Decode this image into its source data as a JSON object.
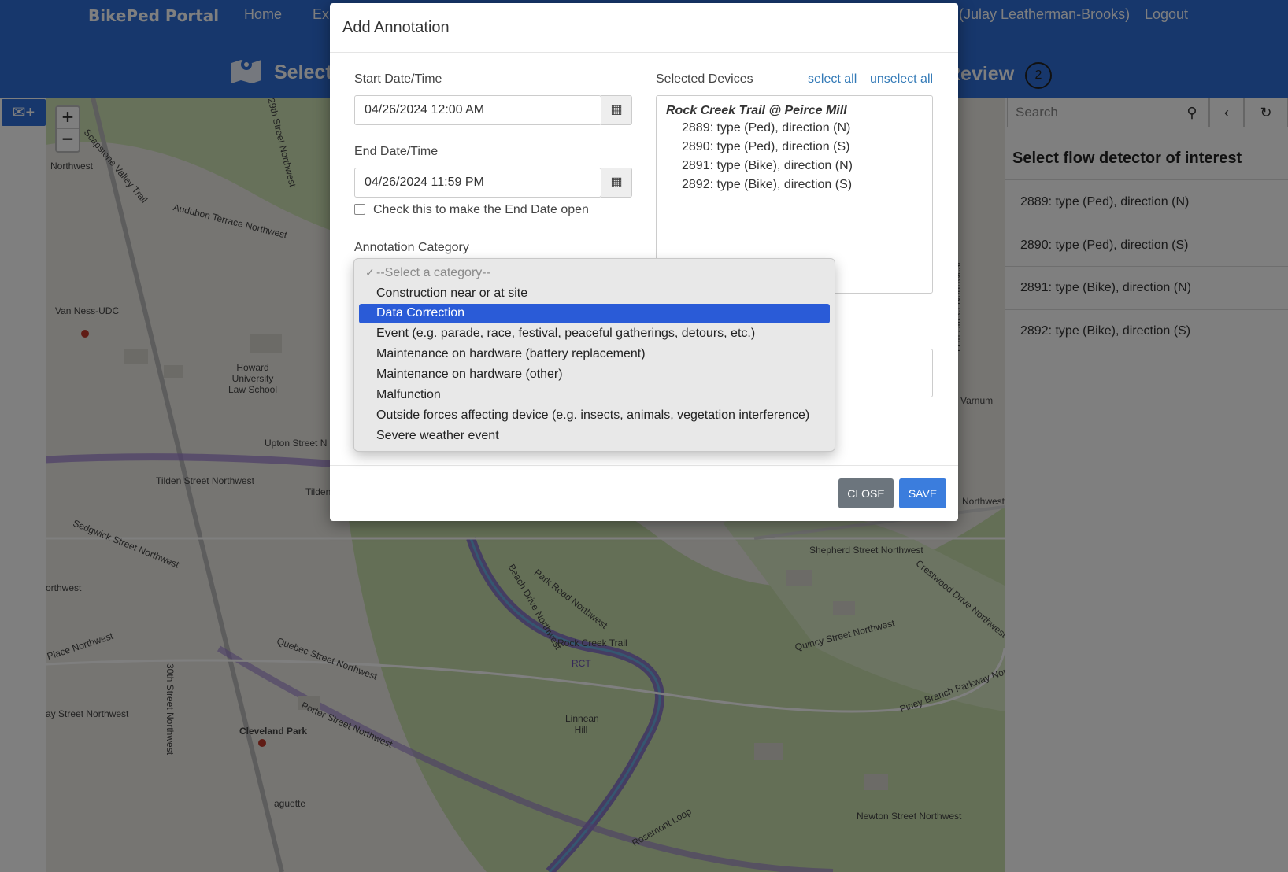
{
  "navbar": {
    "brand": "BikePed Portal",
    "links": [
      "Home",
      "Exp",
      "(Julay Leatherman-Brooks)",
      "Logout"
    ]
  },
  "stepbar": {
    "select_label": "Select",
    "review_label": "Review",
    "review_number": "2"
  },
  "map": {
    "labels": [
      "Van Ness-UDC",
      "Howard University Law School",
      "Upton Street N",
      "Tilden Street Northwest",
      "Tilden Stre",
      "Sedgwick Street Northwest",
      "Quebec Street Northwest",
      "Porter Street Northwest",
      "Cleveland Park",
      "Linnean Hill",
      "RCT",
      "Rock Creek Trail",
      "Park Road Northwest",
      "Beach Drive Northwest",
      "Shepherd Street Northwest",
      "Quincy Street Northwest",
      "Crestwood Drive Northwest",
      "Piney Branch Parkway Northwest",
      "Newton Street Northwest",
      "Rosemont Loop",
      "Audubon Terrace Northwest",
      "Northwest",
      "29th Street Northwest",
      "30th Street Northwest",
      "17th Street Northwest",
      "Varnum",
      "Northwest",
      "aguette",
      "Place Northwest",
      "ay Street Northwest",
      "orthwest",
      "Scapstone Valley Trail"
    ]
  },
  "rpanel": {
    "search_placeholder": "Search",
    "title": "Select flow detector of interest",
    "items": [
      "2889: type (Ped), direction (N)",
      "2890: type (Ped), direction (S)",
      "2891: type (Bike), direction (N)",
      "2892: type (Bike), direction (S)"
    ]
  },
  "modal": {
    "title": "Add Annotation",
    "start_label": "Start Date/Time",
    "start_value": "04/26/2024 12:00 AM",
    "end_label": "End Date/Time",
    "end_value": "04/26/2024 11:59 PM",
    "open_end_label": "Check this to make the End Date open",
    "category_label": "Annotation Category",
    "devices_label": "Selected Devices",
    "select_all": "select all",
    "unselect_all": "unselect all",
    "device_group": "Rock Creek Trail @ Peirce Mill",
    "devices": [
      "2889: type (Ped), direction (N)",
      "2890: type (Ped), direction (S)",
      "2891: type (Bike), direction (N)",
      "2892: type (Bike), direction (S)"
    ],
    "close_label": "CLOSE",
    "save_label": "SAVE"
  },
  "dropdown": {
    "options": [
      "--Select a category--",
      "Construction near or at site",
      "Data Correction",
      "Event (e.g. parade, race, festival, peaceful gatherings, detours, etc.)",
      "Maintenance on hardware (battery replacement)",
      "Maintenance on hardware (other)",
      "Malfunction",
      "Outside forces affecting device (e.g. insects, animals, vegetation interference)",
      "Severe weather event"
    ],
    "highlighted": "Data Correction"
  },
  "colors": {
    "nav_blue": "#2f6fd9",
    "highlight": "#2a5bd7",
    "close_btn": "#6c757d",
    "save_btn": "#3b7ddd"
  }
}
